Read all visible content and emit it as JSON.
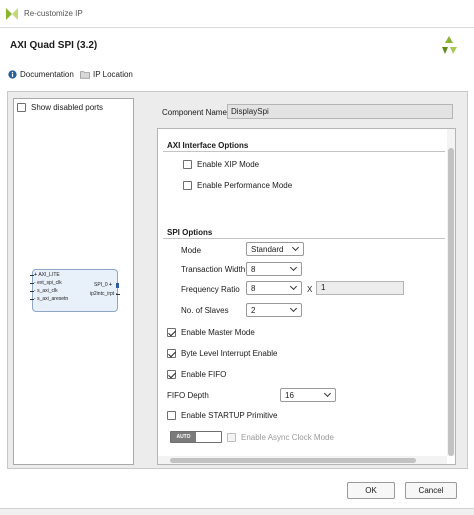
{
  "window": {
    "title": "Re-customize IP"
  },
  "header": {
    "title": "AXI Quad SPI (3.2)",
    "brand_icon": "vivado-logo-icon"
  },
  "links": {
    "documentation": "Documentation",
    "ip_location": "IP Location"
  },
  "left": {
    "show_disabled_ports": "Show disabled ports",
    "ip_ports": {
      "axi_lite": "AXI_LITE",
      "axi_clk": "s_axi_clk",
      "ext_clk": "ext_spi_clk",
      "aresetn": "s_axi_aresetn",
      "spi": "SPI_0",
      "intr": "ip2intc_irpt"
    }
  },
  "component": {
    "label": "Component Name",
    "value": "DisplaySpi"
  },
  "axi_interface": {
    "title": "AXI Interface Options",
    "enable_xip": "Enable XIP Mode",
    "enable_performance": "Enable Performance Mode"
  },
  "spi_options": {
    "title": "SPI Options",
    "mode_label": "Mode",
    "mode_value": "Standard",
    "transaction_width_label": "Transaction Width",
    "transaction_width_value": "8",
    "frequency_ratio_label": "Frequency Ratio",
    "frequency_ratio_value": "8",
    "frequency_ratio_x": "X",
    "frequency_ratio_mult": "1",
    "slaves_label": "No. of Slaves",
    "slaves_value": "2",
    "enable_master_mode": "Enable Master Mode",
    "byte_level_interrupt": "Byte Level Interrupt Enable",
    "enable_fifo": "Enable FIFO",
    "fifo_depth_label": "FIFO Depth",
    "fifo_depth_value": "16",
    "enable_startup": "Enable STARTUP Primitive",
    "auto_label": "AUTO",
    "async_clock_mode": "Enable Async Clock Mode"
  },
  "buttons": {
    "ok": "OK",
    "cancel": "Cancel"
  },
  "colors": {
    "ip_block_fill": "#e8f0fa",
    "ip_block_border": "#8ea7c8",
    "brand_green": "#8bb531"
  }
}
